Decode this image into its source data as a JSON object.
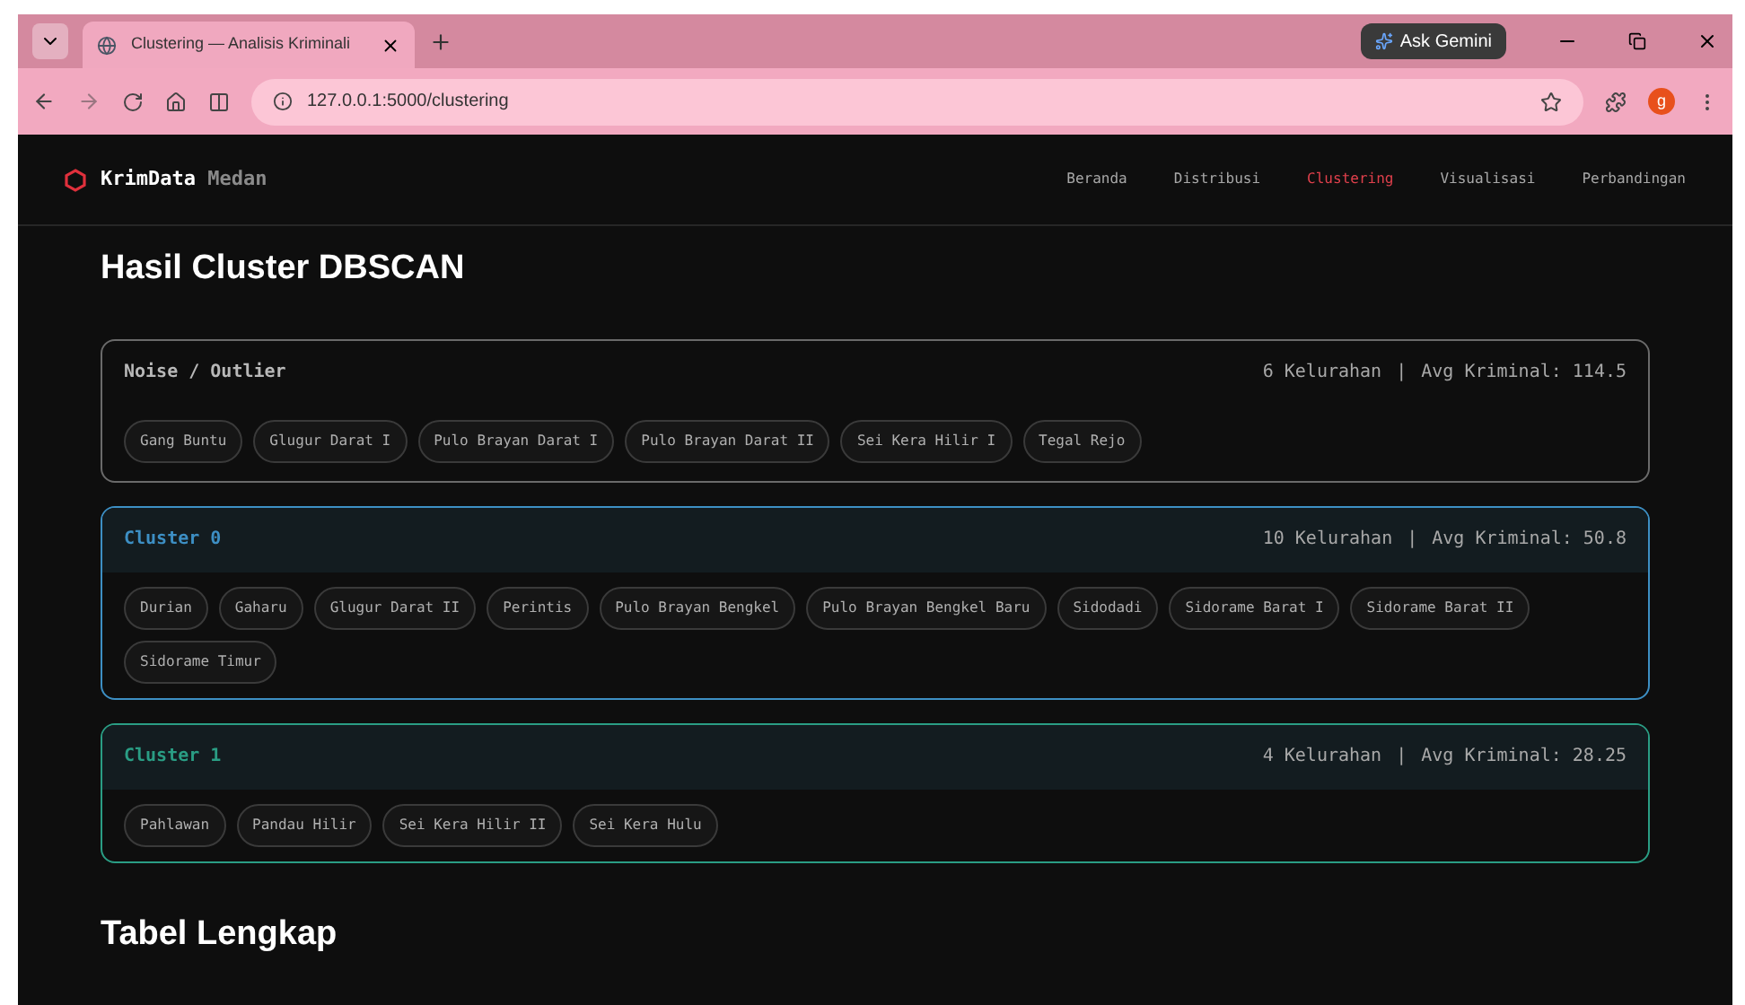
{
  "browser": {
    "tab_title": "Clustering — Analisis Kriminali",
    "url": "127.0.0.1:5000/clustering",
    "gemini": "Ask Gemini",
    "profile_initial": "g"
  },
  "nav": {
    "brand": "KrimData",
    "brand_suffix": "Medan",
    "items": [
      {
        "label": "Beranda",
        "selected": false
      },
      {
        "label": "Distribusi",
        "selected": false
      },
      {
        "label": "Clustering",
        "selected": true
      },
      {
        "label": "Visualisasi",
        "selected": false
      },
      {
        "label": "Perbandingan",
        "selected": false
      }
    ]
  },
  "heading": "Hasil Cluster DBSCAN",
  "clusters": [
    {
      "kind": "noise",
      "title": "Noise / Outlier",
      "color": "#b8b8b8",
      "count": "6 Kelurahan",
      "separator": "|",
      "avg": "Avg Kriminal: 114.5",
      "members": [
        "Gang Buntu",
        "Glugur Darat I",
        "Pulo Brayan Darat I",
        "Pulo Brayan Darat II",
        "Sei Kera Hilir I",
        "Tegal Rejo"
      ]
    },
    {
      "kind": "cluster",
      "title": "Cluster 0",
      "color": "#3d8fc4",
      "count": "10 Kelurahan",
      "separator": "|",
      "avg": "Avg Kriminal: 50.8",
      "members": [
        "Durian",
        "Gaharu",
        "Glugur Darat II",
        "Perintis",
        "Pulo Brayan Bengkel",
        "Pulo Brayan Bengkel Baru",
        "Sidodadi",
        "Sidorame Barat I",
        "Sidorame Barat II",
        "Sidorame Timur"
      ]
    },
    {
      "kind": "cluster",
      "title": "Cluster 1",
      "color": "#2a9d84",
      "count": "4 Kelurahan",
      "separator": "|",
      "avg": "Avg Kriminal: 28.25",
      "members": [
        "Pahlawan",
        "Pandau Hilir",
        "Sei Kera Hilir II",
        "Sei Kera Hulu"
      ]
    }
  ],
  "table_heading": "Tabel Lengkap"
}
